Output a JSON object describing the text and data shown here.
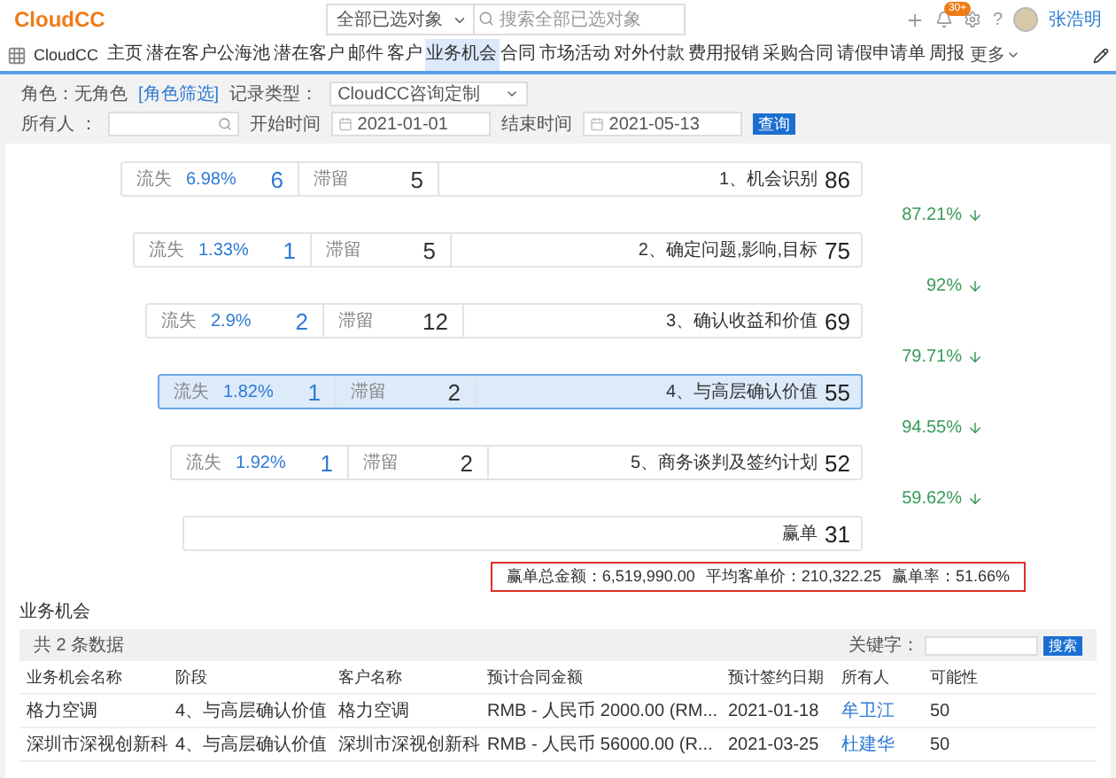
{
  "topbar": {
    "logo": "CloudCC",
    "search_scope": "全部已选对象",
    "search": {
      "placeholder": "搜索全部已选对象"
    },
    "notification_badge": "30+",
    "help": "?",
    "user": "张浩明"
  },
  "nav": {
    "app_name": "CloudCC",
    "tabs": [
      {
        "label": "主页",
        "selected": false
      },
      {
        "label": "潜在客户公海池",
        "selected": false
      },
      {
        "label": "潜在客户",
        "selected": false
      },
      {
        "label": "邮件",
        "selected": false
      },
      {
        "label": "客户",
        "selected": false
      },
      {
        "label": "业务机会",
        "selected": true
      },
      {
        "label": "合同",
        "selected": false
      },
      {
        "label": "市场活动",
        "selected": false
      },
      {
        "label": "对外付款",
        "selected": false
      },
      {
        "label": "费用报销",
        "selected": false
      },
      {
        "label": "采购合同",
        "selected": false
      },
      {
        "label": "请假申请单",
        "selected": false
      },
      {
        "label": "周报",
        "selected": false
      }
    ],
    "more": "更多"
  },
  "filters": {
    "role_label": "角色：无角色",
    "role_link": "[角色筛选]",
    "record_type_label": "记录类型：",
    "record_type": "CloudCC咨询定制",
    "owner_label": "所有人 ：",
    "start_label": "开始时间",
    "start": "2021-01-01",
    "end_label": "结束时间",
    "end": "2021-05-13",
    "query_button": "查询"
  },
  "funnel": {
    "stages": [
      {
        "kind": "stage",
        "lost_label": "流失",
        "lost_rate": "6.98%",
        "lost": "6",
        "stay_label": "滞留",
        "stay": "5",
        "name": "1、机会识别",
        "count": "86",
        "selected": false,
        "conversion": "87.21%"
      },
      {
        "kind": "stage",
        "lost_label": "流失",
        "lost_rate": "1.33%",
        "lost": "1",
        "stay_label": "滞留",
        "stay": "5",
        "name": "2、确定问题,影响,目标",
        "count": "75",
        "selected": false,
        "conversion": "92%"
      },
      {
        "kind": "stage",
        "lost_label": "流失",
        "lost_rate": "2.9%",
        "lost": "2",
        "stay_label": "滞留",
        "stay": "12",
        "name": "3、确认收益和价值",
        "count": "69",
        "selected": false,
        "conversion": "79.71%"
      },
      {
        "kind": "stage",
        "lost_label": "流失",
        "lost_rate": "1.82%",
        "lost": "1",
        "stay_label": "滞留",
        "stay": "2",
        "name": "4、与高层确认价值",
        "count": "55",
        "selected": true,
        "conversion": "94.55%"
      },
      {
        "kind": "stage",
        "lost_label": "流失",
        "lost_rate": "1.92%",
        "lost": "1",
        "stay_label": "滞留",
        "stay": "2",
        "name": "5、商务谈判及签约计划",
        "count": "52",
        "selected": false,
        "conversion": "59.62%"
      },
      {
        "kind": "won",
        "name": "赢单",
        "count": "31",
        "selected": false
      }
    ],
    "summary": [
      "赢单总金额：6,519,990.00",
      "平均客单价：210,322.25",
      "赢单率：51.66%"
    ]
  },
  "opportunities": {
    "title": "业务机会",
    "count_text": "共 2 条数据",
    "keyword_label": "关键字：",
    "search_button": "搜索",
    "columns": [
      {
        "label": "业务机会名称",
        "kind": "text"
      },
      {
        "label": "阶段",
        "kind": "text"
      },
      {
        "label": "客户名称",
        "kind": "text"
      },
      {
        "label": "预计合同金额",
        "kind": "text"
      },
      {
        "label": "预计签约日期",
        "kind": "text"
      },
      {
        "label": "所有人",
        "kind": "link"
      },
      {
        "label": "可能性",
        "kind": "text"
      }
    ],
    "rows": [
      {
        "cells": [
          "格力空调",
          "4、与高层确认价值",
          "格力空调",
          "RMB - 人民币 2000.00 (RM...",
          "2021-01-18",
          "牟卫江",
          "50"
        ]
      },
      {
        "cells": [
          "深圳市深视创新科",
          "4、与高层确认价值",
          "深圳市深视创新科",
          "RMB - 人民币 56000.00 (R...",
          "2021-03-25",
          "杜建华",
          "50"
        ]
      }
    ]
  }
}
